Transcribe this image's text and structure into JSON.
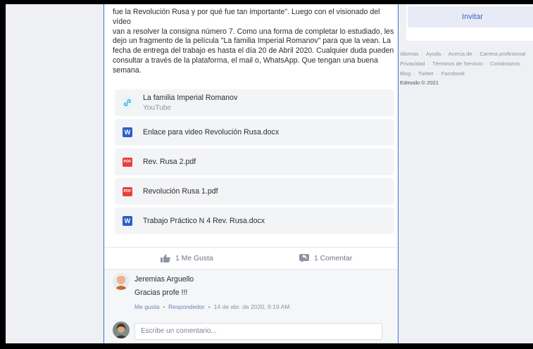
{
  "post": {
    "text_lines": [
      "fue la Revolución Rusa y por qué fue tan importante\". Luego con el visionado del vídeo",
      "van a resolver la consigna número 7. Como una forma de completar lo estudiado, les",
      "dejo un fragmento de la película \"La familia Imperial Romanov\" para que la vean. La",
      "fecha de entrega del trabajo es hasta el día 20 de Abril 2020. Cualquier duda pueden",
      "consultar a través de la plataforma, el mail o, WhatsApp. Que tengan una buena",
      "semana."
    ],
    "attachments": [
      {
        "type": "link-icon",
        "name": "La familia Imperial Romanov",
        "source": "YouTube"
      },
      {
        "type": "word-icon",
        "name": "Enlace para video Revolución Rusa.docx",
        "icon_letter": "W"
      },
      {
        "type": "pdf-icon",
        "name": "Rev. Rusa 2.pdf",
        "icon_letter": "PDF"
      },
      {
        "type": "pdf-icon",
        "name": "Revolución Rusa 1.pdf",
        "icon_letter": "PDF"
      },
      {
        "type": "word-icon",
        "name": "Trabajo Práctico N 4 Rev. Rusa.docx",
        "icon_letter": "W"
      }
    ],
    "like_label": "1 Me Gusta",
    "comment_label": "1 Comentar"
  },
  "comment": {
    "author": "Jeremias Arguello",
    "text": "Gracias profe !!!",
    "like_link": "Me gusta",
    "reply_link": "Respondedor",
    "timestamp": "14 de abr. de 2020, 9:19 AM"
  },
  "comment_input": {
    "placeholder": "Escribe un comentario..."
  },
  "sidebar": {
    "invite_label": "Invitar",
    "footer_links": [
      [
        "Idiomas",
        "Ayuda",
        "Acerca de",
        "Carrera profesional"
      ],
      [
        "Privacidad",
        "Términos de Servicio",
        "Contáctanos"
      ],
      [
        "Blog",
        "Twitter",
        "Facebook"
      ]
    ],
    "copyright": "Edmodo © 2021"
  },
  "colors": {
    "accent": "#3f70d6",
    "word": "#2b5ec9",
    "pdf": "#e5403e",
    "link": "#24a6d6"
  }
}
